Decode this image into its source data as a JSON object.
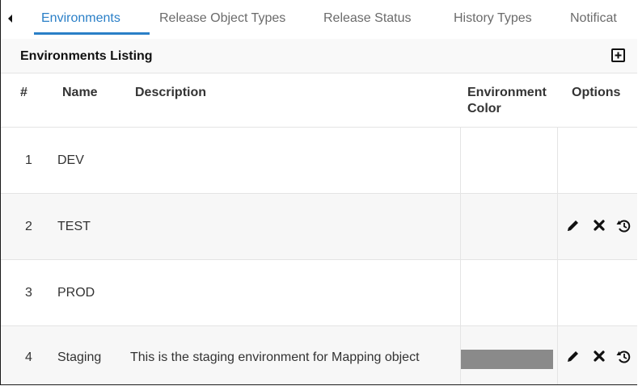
{
  "tabs": [
    {
      "label": "Environments",
      "active": true
    },
    {
      "label": "Release Object Types",
      "active": false
    },
    {
      "label": "Release Status",
      "active": false
    },
    {
      "label": "History Types",
      "active": false
    },
    {
      "label": "Notificat",
      "active": false
    }
  ],
  "listing": {
    "title": "Environments Listing",
    "add_icon": "plus-square-icon"
  },
  "table": {
    "columns": {
      "index": "#",
      "name": "Name",
      "description": "Description",
      "color_line1": "Environment",
      "color_line2": "Color",
      "options": "Options"
    },
    "rows": [
      {
        "index": "1",
        "name": "DEV",
        "description": "",
        "color": null,
        "options": []
      },
      {
        "index": "2",
        "name": "TEST",
        "description": "",
        "color": null,
        "options": [
          "edit-icon",
          "delete-icon",
          "history-icon"
        ]
      },
      {
        "index": "3",
        "name": "PROD",
        "description": "",
        "color": null,
        "options": []
      },
      {
        "index": "4",
        "name": "Staging",
        "description": "This is the staging environment for Mapping object",
        "color": "#8a8a8a",
        "options": [
          "edit-icon",
          "delete-icon",
          "history-icon"
        ]
      }
    ]
  },
  "colors": {
    "accent": "#2a7fc7",
    "row_alt": "#f7f7f7",
    "header_bg": "#f9f9f9"
  }
}
